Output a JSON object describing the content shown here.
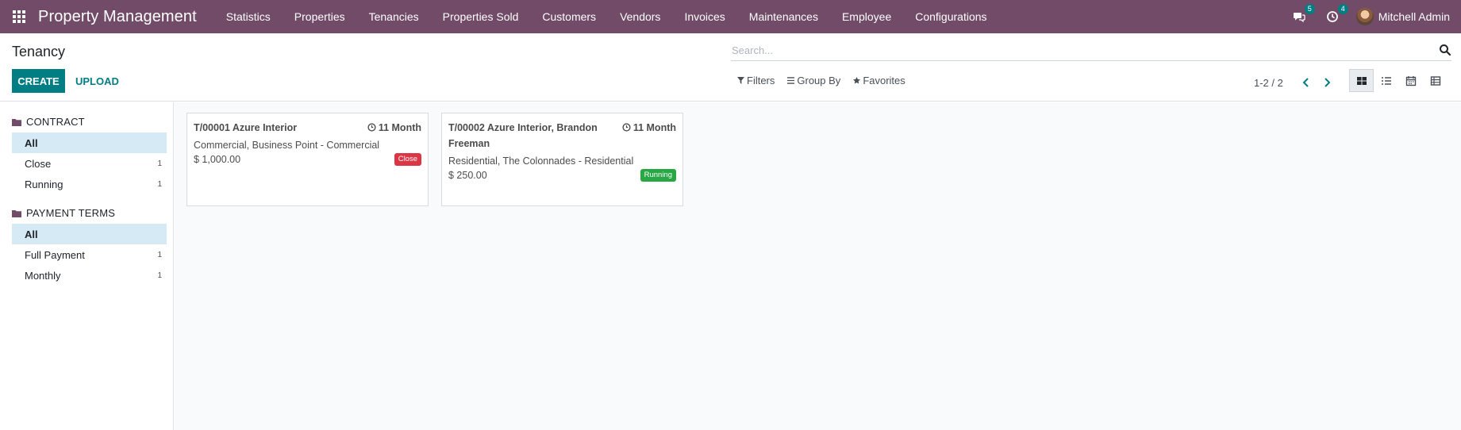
{
  "navbar": {
    "brand": "Property Management",
    "menu": [
      "Statistics",
      "Properties",
      "Tenancies",
      "Properties Sold",
      "Customers",
      "Vendors",
      "Invoices",
      "Maintenances",
      "Employee",
      "Configurations"
    ],
    "messages_count": "5",
    "activities_count": "4",
    "user_name": "Mitchell Admin",
    "bg_color": "#714b67"
  },
  "control_panel": {
    "title": "Tenancy",
    "create_label": "CREATE",
    "upload_label": "UPLOAD",
    "search_placeholder": "Search...",
    "filters_label": "Filters",
    "groupby_label": "Group By",
    "favorites_label": "Favorites",
    "pager_value": "1-2 / 2",
    "views": [
      "kanban-icon",
      "list-icon",
      "calendar-icon",
      "pivot-icon"
    ],
    "active_view": "kanban",
    "accent_color": "#017e84"
  },
  "sidebar": {
    "sections": [
      {
        "title": "CONTRACT",
        "items": [
          {
            "label": "All",
            "count": "",
            "active": true
          },
          {
            "label": "Close",
            "count": "1",
            "active": false
          },
          {
            "label": "Running",
            "count": "1",
            "active": false
          }
        ]
      },
      {
        "title": "PAYMENT TERMS",
        "items": [
          {
            "label": "All",
            "count": "",
            "active": true
          },
          {
            "label": "Full Payment",
            "count": "1",
            "active": false
          },
          {
            "label": "Monthly",
            "count": "1",
            "active": false
          }
        ]
      }
    ]
  },
  "cards": [
    {
      "title": "T/00001 Azure Interior",
      "duration": "11 Month",
      "property": "Commercial, Business Point - Commercial",
      "amount": "$ 1,000.00",
      "status": "Close",
      "status_color": "#dc3545"
    },
    {
      "title": "T/00002 Azure Interior, Brandon Freeman",
      "duration": "11 Month",
      "property": "Residential, The Colonnades - Residential",
      "amount": "$ 250.00",
      "status": "Running",
      "status_color": "#28a745"
    }
  ]
}
